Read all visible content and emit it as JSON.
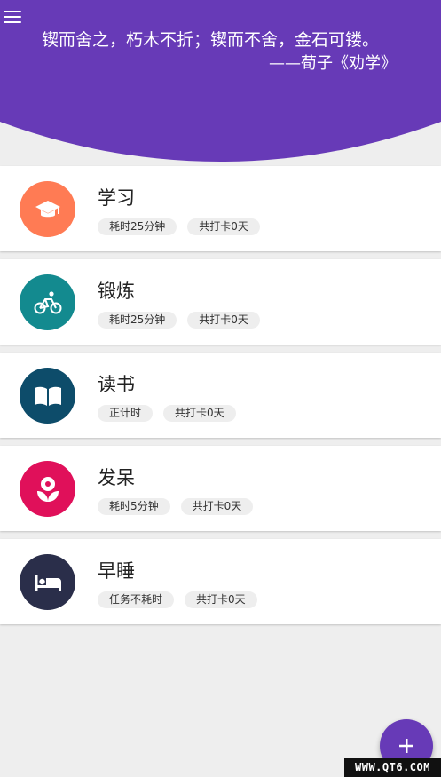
{
  "header": {
    "quote": "锲而舍之，朽木不折；锲而不舍，金石可镂。",
    "source": "——荀子《劝学》",
    "color": "#673ab7"
  },
  "tasks": [
    {
      "name": "学习",
      "icon": "graduation-cap-icon",
      "color": "#ff7b54",
      "chips": [
        "耗时25分钟",
        "共打卡0天"
      ]
    },
    {
      "name": "锻炼",
      "icon": "cyclist-icon",
      "color": "#138a8f",
      "chips": [
        "耗时25分钟",
        "共打卡0天"
      ]
    },
    {
      "name": "读书",
      "icon": "open-book-icon",
      "color": "#0d4c6a",
      "chips": [
        "正计时",
        "共打卡0天"
      ]
    },
    {
      "name": "发呆",
      "icon": "flower-icon",
      "color": "#e0105a",
      "chips": [
        "耗时5分钟",
        "共打卡0天"
      ]
    },
    {
      "name": "早睡",
      "icon": "bed-icon",
      "color": "#2a2e4a",
      "chips": [
        "任务不耗时",
        "共打卡0天"
      ]
    }
  ],
  "fab": {
    "label": "+",
    "icon": "plus-icon"
  },
  "watermark": "WWW.QT6.COM"
}
